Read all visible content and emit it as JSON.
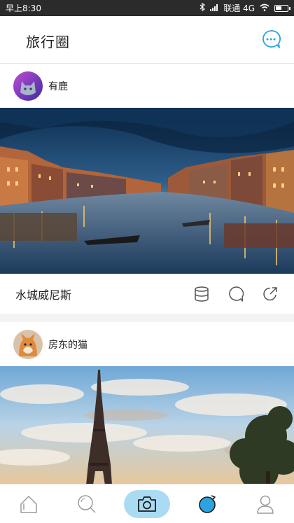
{
  "status_bar": {
    "time": "早上8:30",
    "carrier": "联通 4G"
  },
  "header": {
    "title": "旅行圈"
  },
  "posts": [
    {
      "author": "有鹿",
      "caption": "水城威尼斯"
    },
    {
      "author": "房东的猫"
    }
  ],
  "colors": {
    "accent": "#2aa3e0",
    "camera_bg": "#a9dcf3"
  }
}
